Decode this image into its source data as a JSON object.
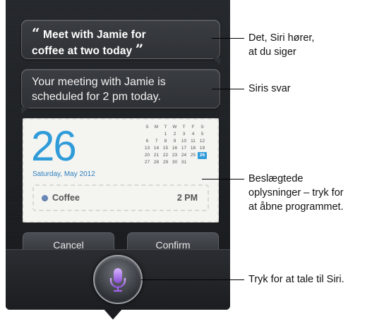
{
  "user_query": {
    "open_quote": "“",
    "line1": "Meet with Jamie for",
    "line2": "coffee at two today",
    "close_quote": "”"
  },
  "siri_reply": {
    "line1": "Your meeting with Jamie is",
    "line2": "scheduled for 2 pm today."
  },
  "calendar": {
    "day": "26",
    "date_label": "Saturday, May 2012",
    "weekday_headers": [
      "S",
      "M",
      "T",
      "W",
      "T",
      "F",
      "S"
    ],
    "weeks": [
      [
        "",
        "",
        "1",
        "2",
        "3",
        "4",
        "5"
      ],
      [
        "6",
        "7",
        "8",
        "9",
        "10",
        "11",
        "12"
      ],
      [
        "13",
        "14",
        "15",
        "16",
        "17",
        "18",
        "19"
      ],
      [
        "20",
        "21",
        "22",
        "23",
        "24",
        "25",
        "26"
      ],
      [
        "27",
        "28",
        "29",
        "30",
        "31",
        "",
        ""
      ]
    ],
    "highlight_day": "26",
    "accent_color": "#2f9bd9"
  },
  "event": {
    "name": "Coffee",
    "time": "2 PM",
    "dot_color": "#6a88b7"
  },
  "buttons": {
    "cancel": "Cancel",
    "confirm": "Confirm"
  },
  "mic": {
    "icon": "microphone-icon",
    "color": "#b07be8"
  },
  "callouts": {
    "heard_line1": "Det, Siri hører,",
    "heard_line2": "at du siger",
    "answer": "Siris svar",
    "info_line1": "Beslægtede",
    "info_line2": "oplysninger – tryk for",
    "info_line3": "at åbne programmet.",
    "speak": "Tryk for at tale til Siri."
  }
}
